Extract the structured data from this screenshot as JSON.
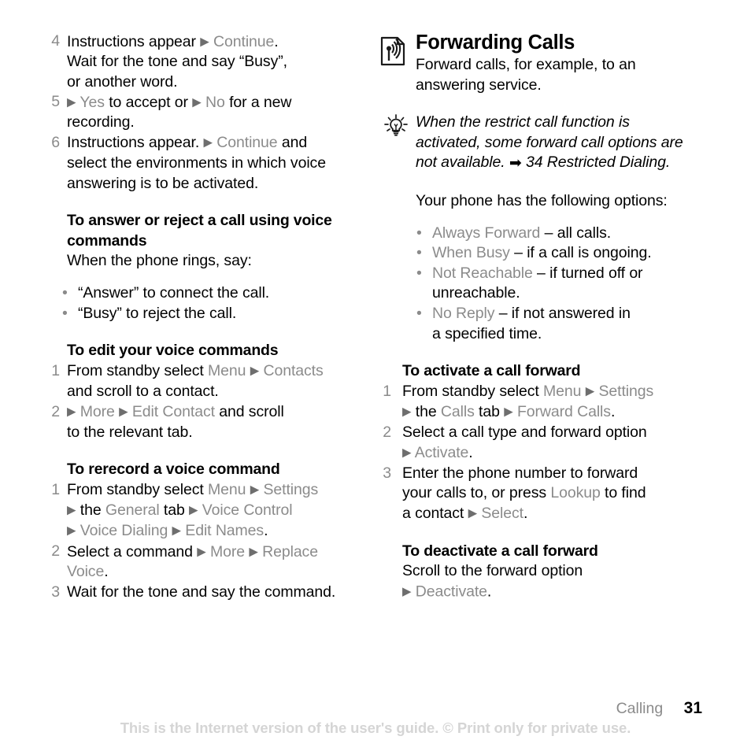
{
  "colors": {
    "menu_term": "#8b8b8b",
    "body_text": "#010101",
    "footer_muted": "#d5d5d5",
    "list_number": "#8b8b8b"
  },
  "glyphs": {
    "triangle": "▶",
    "bullet": "•",
    "solid_arrow": "➡",
    "dash": "–"
  },
  "left_column": {
    "steps_voice_answering": [
      {
        "number": "4",
        "parts": [
          {
            "t": "Instructions appear ",
            "s": "plain"
          },
          {
            "t": "▶",
            "s": "tri"
          },
          {
            "t": " ",
            "s": "plain"
          },
          {
            "t": "Continue",
            "s": "menu"
          },
          {
            "t": ".",
            "s": "plain"
          },
          {
            "t": "\nWait for the tone and say “Busy”,\nor another word.",
            "s": "plain"
          }
        ],
        "text": "Instructions appear ▶ Continue. Wait for the tone and say “Busy”, or another word."
      },
      {
        "number": "5",
        "text": "▶ Yes to accept or ▶ No for a new recording."
      },
      {
        "number": "6",
        "text": "Instructions appear. ▶ Continue and select the environments in which voice answering is to be activated."
      }
    ],
    "section_answer_reject": {
      "heading": "To answer or reject a call using voice commands",
      "intro": "When the phone rings, say:",
      "bullets": [
        "“Answer” to connect the call.",
        "“Busy” to reject the call."
      ]
    },
    "section_edit_commands": {
      "heading": "To edit your voice commands",
      "steps": [
        {
          "number": "1",
          "text": "From standby select Menu ▶ Contacts and scroll to a contact."
        },
        {
          "number": "2",
          "text": "▶ More ▶ Edit Contact and scroll to the relevant tab."
        }
      ]
    },
    "section_rerecord": {
      "heading": "To rerecord a voice command",
      "steps": [
        {
          "number": "1",
          "text": "From standby select Menu ▶ Settings ▶ the General tab ▶ Voice Control ▶ Voice Dialing ▶ Edit Names."
        },
        {
          "number": "2",
          "text": "Select a command ▶ More ▶ Replace Voice."
        },
        {
          "number": "3",
          "text": "Wait for the tone and say the command."
        }
      ]
    },
    "terms": {
      "continue": "Continue",
      "yes": "Yes",
      "no": "No",
      "menu": "Menu",
      "contacts": "Contacts",
      "more": "More",
      "edit_contact": "Edit Contact",
      "settings": "Settings",
      "general": "General",
      "voice_control": "Voice Control",
      "voice_dialing": "Voice Dialing",
      "edit_names": "Edit Names",
      "replace": "Replace",
      "voice": "Voice"
    },
    "fragments": {
      "s4_a": "Instructions appear ",
      "s4_b": "Wait for the tone and say “Busy”,",
      "s4_c": "or another word.",
      "s5_a": " to accept or ",
      "s5_b": " for a new",
      "s5_c": "recording.",
      "s6_a": "Instructions appear. ",
      "s6_b": " and",
      "s6_c": "select the environments in which voice",
      "s6_d": "answering is to be activated.",
      "edit1_a": "From standby select ",
      "edit1_b": "and scroll to a contact.",
      "edit2_a": " and scroll",
      "edit2_b": "to the relevant tab.",
      "rer1_a": "From standby select ",
      "rer1_b": " the ",
      "rer1_c": " tab ",
      "rer2_a": "Select a command ",
      "rer3_a": "Wait for the tone and say the command."
    }
  },
  "right_column": {
    "chapter_icon_name": "forwarding-calls-icon",
    "title": "Forwarding Calls",
    "intro": "Forward calls, for example, to an answering service.",
    "intro_lines": [
      "Forward calls, for example, to an",
      "answering service."
    ],
    "tip": {
      "icon_name": "lightbulb-tip-icon",
      "lines": [
        "When the restrict call function is",
        "activated, some forward call options are",
        "not available."
      ],
      "reference": "34 Restricted Dialing.",
      "full": "When the restrict call function is activated, some forward call options are not available. ➡ 34 Restricted Dialing."
    },
    "options_intro": "Your phone has the following options:",
    "options": [
      {
        "term": "Always Forward",
        "desc_lines": [
          "– all calls."
        ]
      },
      {
        "term": "When Busy",
        "desc_lines": [
          "– if a call is ongoing."
        ]
      },
      {
        "term": "Not Reachable",
        "desc_lines": [
          "– if turned off or",
          "unreachable."
        ]
      },
      {
        "term": "No Reply",
        "desc_lines": [
          "– if not answered in",
          "a specified time."
        ]
      }
    ],
    "section_activate": {
      "heading": "To activate a call forward",
      "steps": [
        {
          "number": "1",
          "text": "From standby select Menu ▶ Settings ▶ the Calls tab ▶ Forward Calls."
        },
        {
          "number": "2",
          "text": "Select a call type and forward option ▶ Activate."
        },
        {
          "number": "3",
          "text": "Enter the phone number to forward your calls to, or press Lookup to find a contact ▶ Select."
        }
      ]
    },
    "section_deactivate": {
      "heading": "To deactivate a call forward",
      "lines": [
        "Scroll to the forward option"
      ],
      "action": "Deactivate"
    },
    "terms": {
      "menu": "Menu",
      "settings": "Settings",
      "calls": "Calls",
      "forward_calls": "Forward Calls",
      "activate": "Activate",
      "lookup": "Lookup",
      "select": "Select",
      "deactivate": "Deactivate"
    },
    "fragments": {
      "act1_a": "From standby select ",
      "act1_b": " the ",
      "act1_c": " tab ",
      "act2_a": "Select a call type and forward option",
      "act3_a": "Enter the phone number to forward",
      "act3_b": "your calls to, or press ",
      "act3_c": " to find",
      "act3_d": "a contact "
    }
  },
  "footer": {
    "chapter": "Calling",
    "page_number": "31",
    "copyright": "This is the Internet version of the user's guide. © Print only for private use."
  }
}
